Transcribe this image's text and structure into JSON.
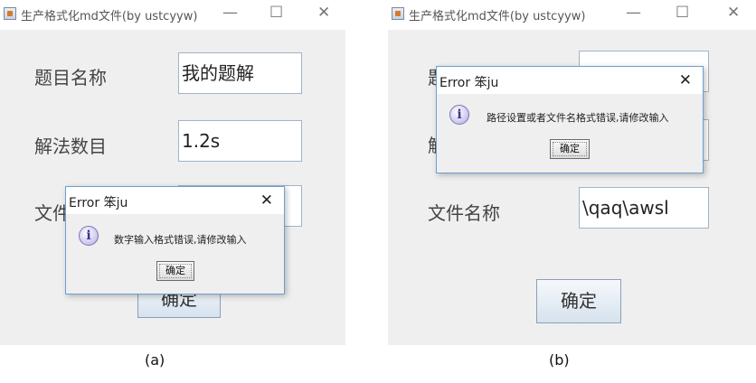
{
  "windows": [
    {
      "title": "生产格式化md文件(by ustcyyw)",
      "controls": {
        "minimize": "—",
        "maximize": "☐",
        "close": "✕"
      },
      "fields": [
        {
          "label": "题目名称",
          "value": "我的题解"
        },
        {
          "label": "解法数目",
          "value": "1.2s"
        },
        {
          "label": "文件",
          "value": ""
        }
      ],
      "confirm_label": "确定",
      "dialog": {
        "title": "Error 笨ju",
        "close": "✕",
        "message": "数字输入格式错误,请修改输入",
        "ok_label": "确定",
        "icon_glyph": "i"
      }
    },
    {
      "title": "生产格式化md文件(by ustcyyw)",
      "controls": {
        "minimize": "—",
        "maximize": "☐",
        "close": "✕"
      },
      "fields": [
        {
          "label": "题",
          "value": ""
        },
        {
          "label": "解",
          "value": ""
        },
        {
          "label": "文件名称",
          "value": "\\qaq\\awsl"
        }
      ],
      "confirm_label": "确定",
      "dialog": {
        "title": "Error 笨ju",
        "close": "✕",
        "message": "路径设置或者文件名格式错误,请修改输入",
        "ok_label": "确定",
        "icon_glyph": "i"
      }
    }
  ],
  "captions": [
    "(a)",
    "(b)"
  ],
  "colors": {
    "window_bg": "#efefef",
    "field_border": "#9fb4c8",
    "dialog_border": "#6d9fd4",
    "info_icon": "#c9c4ec"
  }
}
